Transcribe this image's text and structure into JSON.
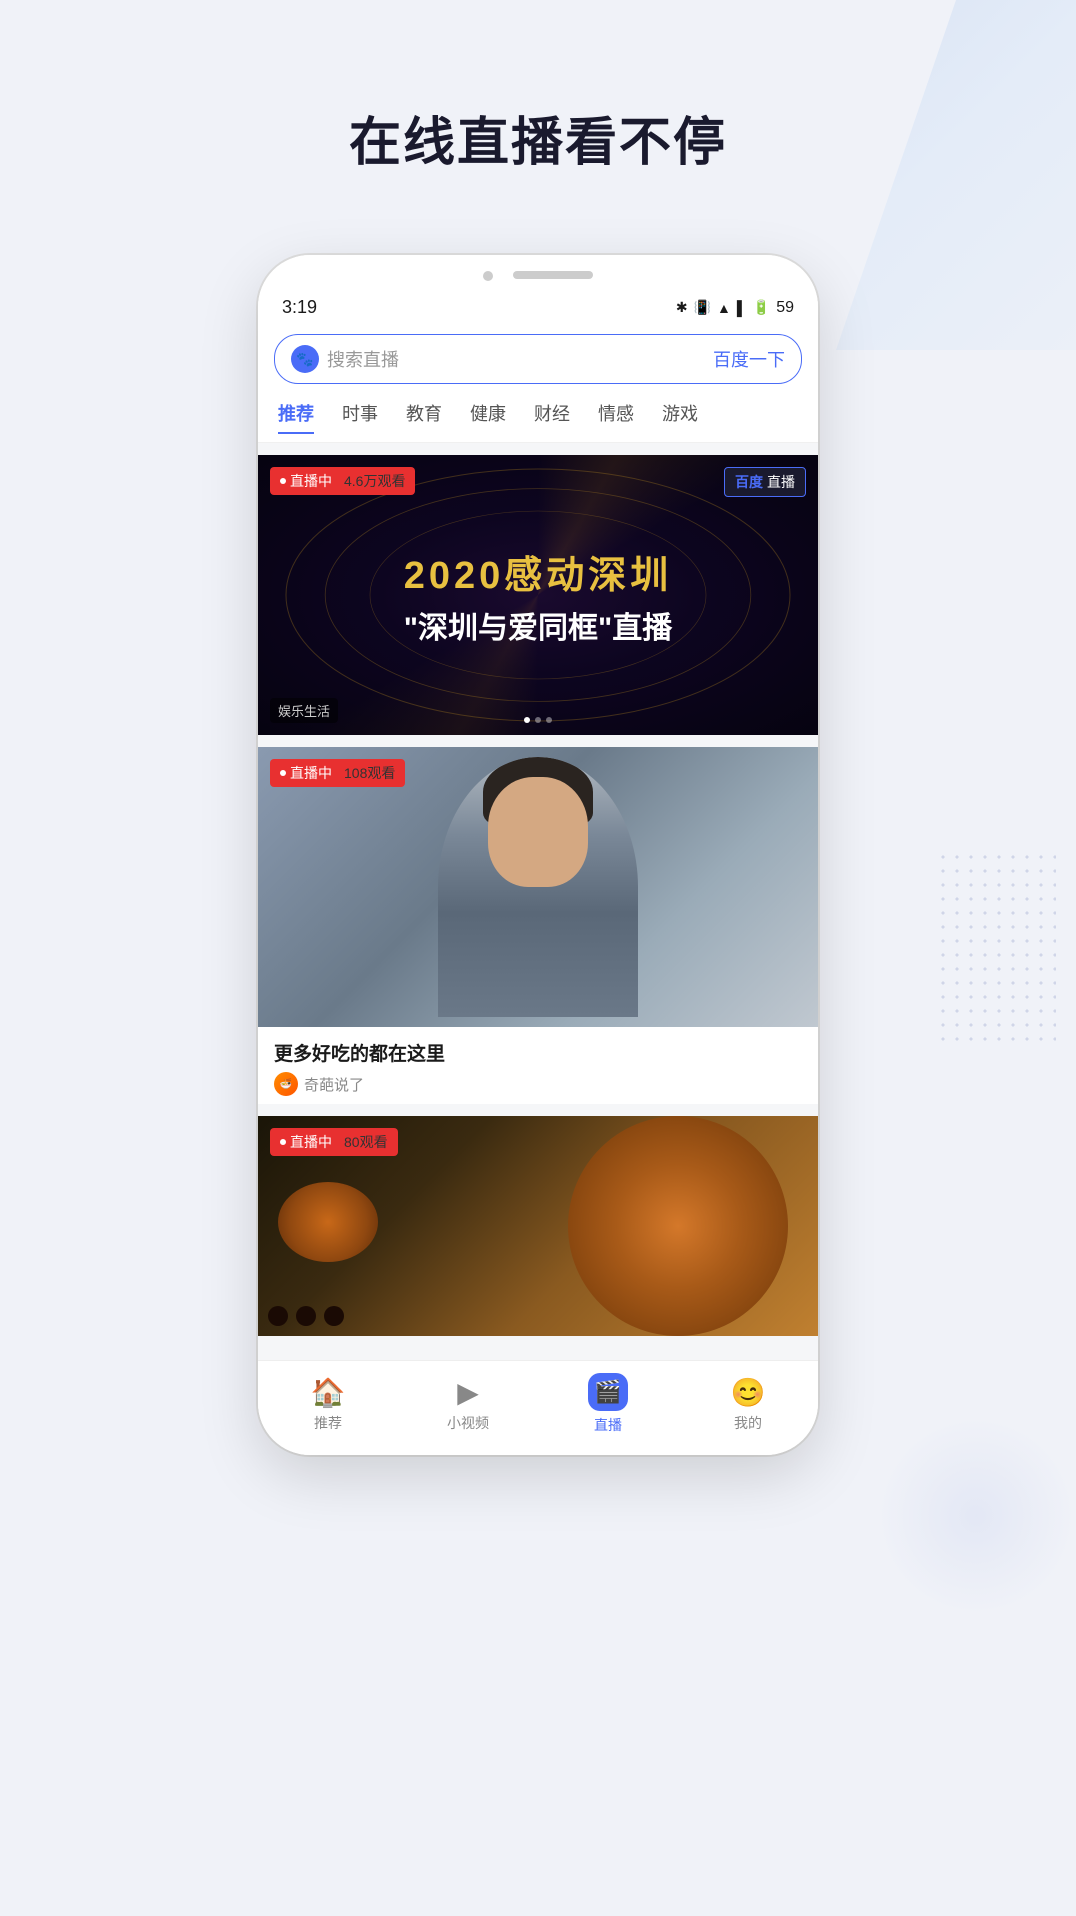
{
  "page": {
    "hero_title": "在线直播看不停",
    "background": {
      "color": "#f0f2f8"
    }
  },
  "status_bar": {
    "time": "3:19",
    "battery": "59"
  },
  "search": {
    "placeholder": "搜索直播",
    "button_label": "百度一下",
    "icon_label": "百度"
  },
  "categories": [
    {
      "id": "recommend",
      "label": "推荐",
      "active": true
    },
    {
      "id": "news",
      "label": "时事",
      "active": false
    },
    {
      "id": "education",
      "label": "教育",
      "active": false
    },
    {
      "id": "health",
      "label": "健康",
      "active": false
    },
    {
      "id": "finance",
      "label": "财经",
      "active": false
    },
    {
      "id": "emotion",
      "label": "情感",
      "active": false
    },
    {
      "id": "game",
      "label": "游戏",
      "active": false
    }
  ],
  "cards": [
    {
      "id": "card1",
      "type": "live_event",
      "live_badge": "直播中",
      "viewers": "4.6万观看",
      "title_year": "2020感动深圳",
      "title_main": "\"深圳与爱同框\"直播",
      "subtitle": "",
      "platform_badge": "百度 直播",
      "tag": "娱乐生活",
      "has_indicator": true
    },
    {
      "id": "card2",
      "type": "live_person",
      "live_badge": "直播中",
      "viewers": "108观看",
      "card_title": "更多好吃的都在这里",
      "author_name": "奇葩说了",
      "author_icon": "🍜"
    },
    {
      "id": "card3",
      "type": "live_food",
      "live_badge": "直播中",
      "viewers": "80观看"
    }
  ],
  "bottom_nav": [
    {
      "id": "home",
      "label": "推荐",
      "icon": "🏠",
      "active": false
    },
    {
      "id": "video",
      "label": "小视频",
      "icon": "▶",
      "active": false
    },
    {
      "id": "live",
      "label": "直播",
      "icon": "🎬",
      "active": true,
      "special": true
    },
    {
      "id": "profile",
      "label": "我的",
      "icon": "😊",
      "active": false
    }
  ]
}
